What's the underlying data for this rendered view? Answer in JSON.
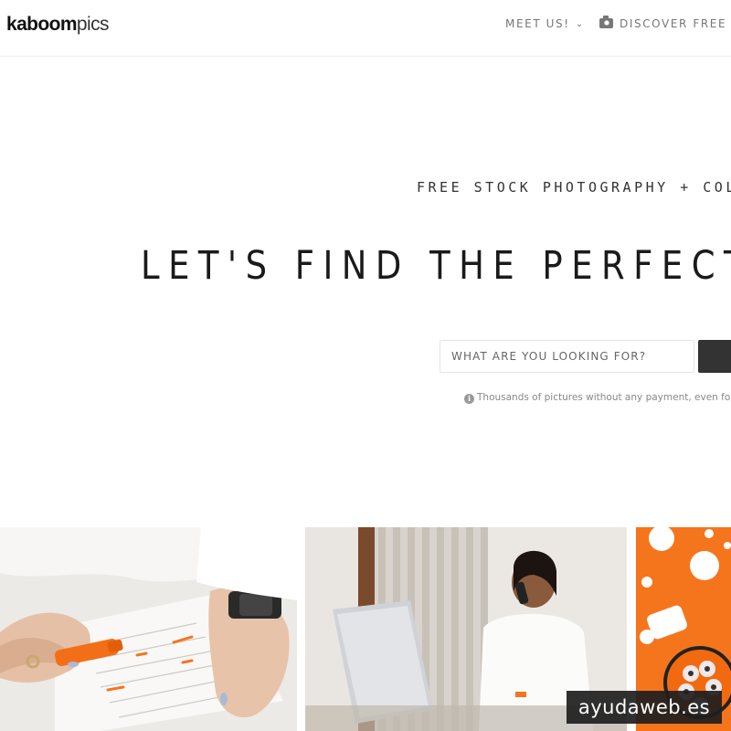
{
  "header": {
    "logo_bold": "kaboom",
    "logo_light": "pics",
    "nav": {
      "meet_label": "MEET US!",
      "discover_label": "DISCOVER FREE PH"
    }
  },
  "hero": {
    "kicker": "FREE STOCK PHOTOGRAPHY + COLO",
    "headline": "LET'S FIND THE PERFECT",
    "search": {
      "placeholder": "WHAT ARE YOU LOOKING FOR?"
    },
    "note": "Thousands of pictures without any payment, even for cor"
  },
  "photos": [
    {
      "name": "photo-highlighter-document",
      "icon": "photo"
    },
    {
      "name": "photo-woman-phone-laptop",
      "icon": "photo"
    },
    {
      "name": "photo-orange-cookies",
      "icon": "photo"
    }
  ],
  "watermark": "ayudaweb.es",
  "colors": {
    "accent": "#f5751d",
    "button": "#333333",
    "nav_text": "#777777"
  }
}
